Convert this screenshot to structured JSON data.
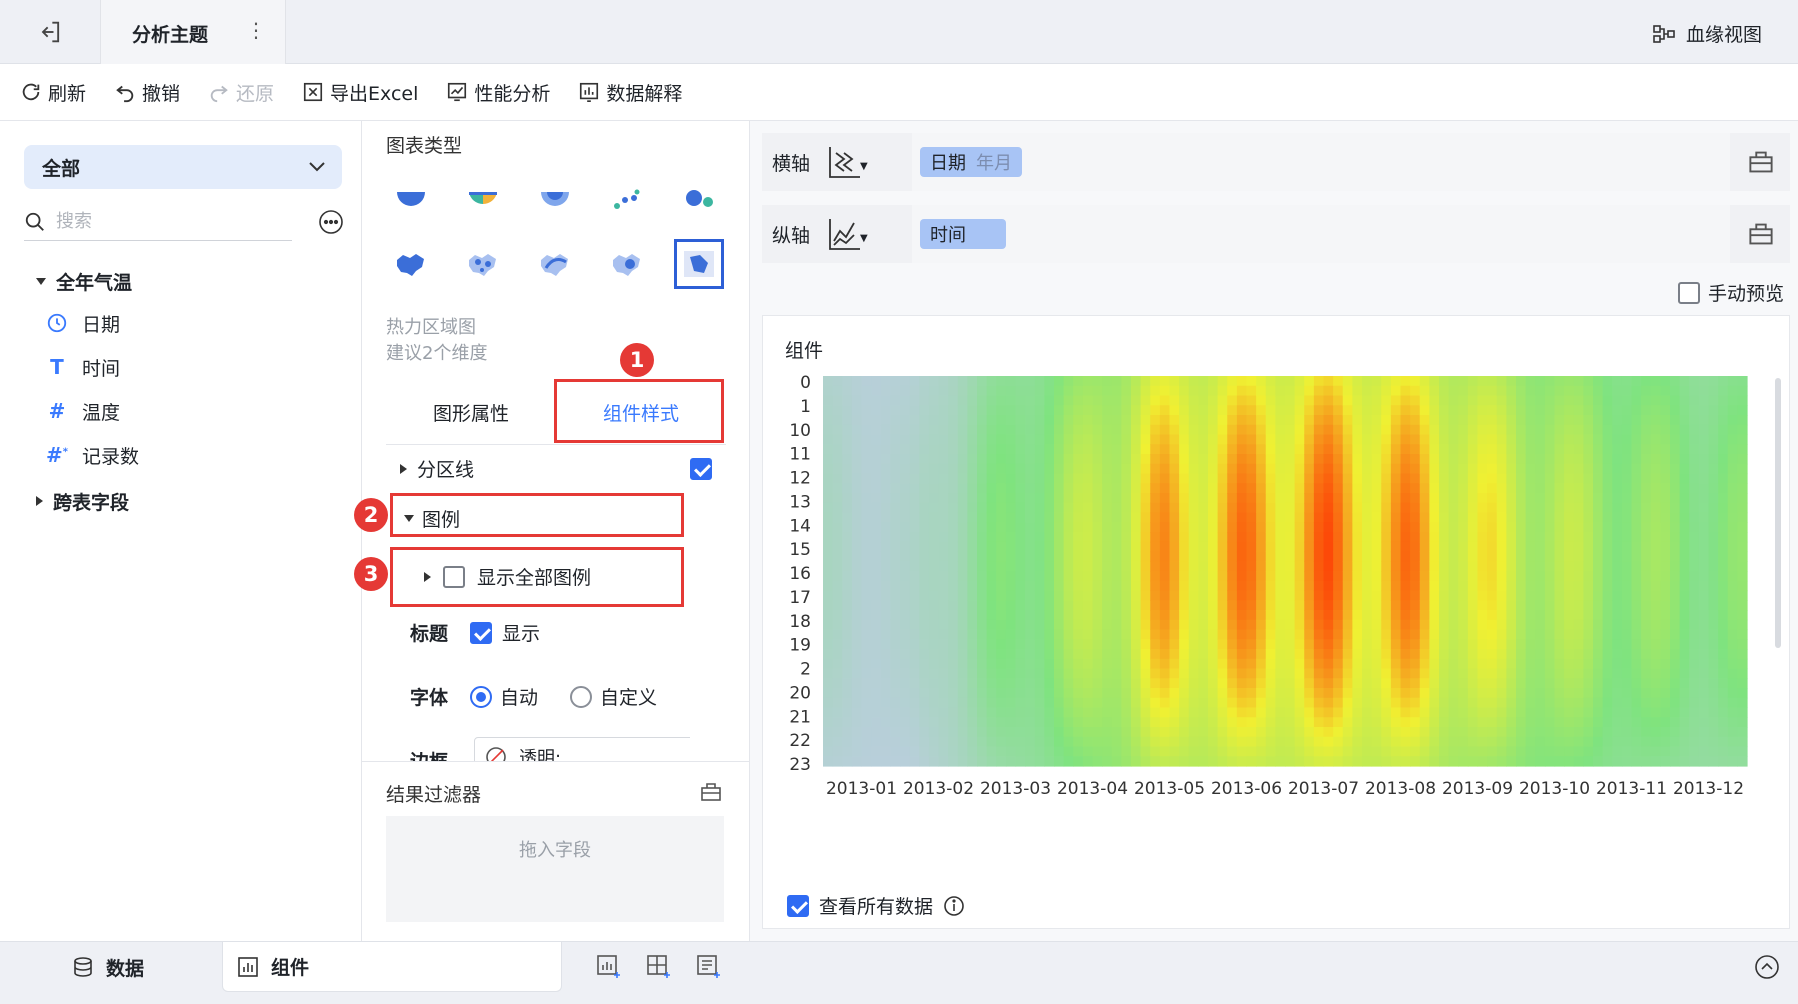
{
  "topbar": {
    "title": "分析主题",
    "lineage_label": "血缘视图"
  },
  "toolbar": {
    "refresh": "刷新",
    "undo": "撤销",
    "redo": "还原",
    "export_excel": "导出Excel",
    "performance": "性能分析",
    "data_explain": "数据解释"
  },
  "left": {
    "dropdown": "全部",
    "search_placeholder": "搜索",
    "group_name": "全年气温",
    "fields": [
      {
        "icon": "clock-icon",
        "name": "日期"
      },
      {
        "icon": "text-icon",
        "name": "时间"
      },
      {
        "icon": "number-icon",
        "name": "温度"
      },
      {
        "icon": "count-icon",
        "name": "记录数"
      }
    ],
    "cross_table": "跨表字段"
  },
  "middle": {
    "chart_type_label": "图表类型",
    "chart_name": "热力区域图",
    "chart_hint": "建议2个维度",
    "tab_shape": "图形属性",
    "tab_style": "组件样式",
    "partition_line": "分区线",
    "legend": "图例",
    "show_all_legend": "显示全部图例",
    "title_label": "标题",
    "title_show": "显示",
    "font_label": "字体",
    "font_auto": "自动",
    "font_custom": "自定义",
    "border_label": "边框",
    "border_value": "透明;",
    "result_filter": "结果过滤器",
    "drop_field": "拖入字段",
    "badges": [
      "1",
      "2",
      "3"
    ]
  },
  "right": {
    "x_axis_label": "横轴",
    "x_field": "日期",
    "x_field_sub": "年月",
    "y_axis_label": "纵轴",
    "y_field": "时间",
    "manual_preview": "手动预览",
    "component_title": "组件",
    "view_all_data": "查看所有数据"
  },
  "chart_data": {
    "type": "heatmap",
    "x_labels": [
      "2013-01",
      "2013-02",
      "2013-03",
      "2013-04",
      "2013-05",
      "2013-06",
      "2013-07",
      "2013-08",
      "2013-09",
      "2013-10",
      "2013-11",
      "2013-12"
    ],
    "y_labels": [
      "0",
      "1",
      "10",
      "11",
      "12",
      "13",
      "14",
      "15",
      "16",
      "17",
      "18",
      "19",
      "2",
      "20",
      "21",
      "22",
      "23"
    ],
    "intensity_by_month": [
      0.15,
      0.12,
      0.35,
      0.55,
      0.85,
      0.9,
      0.95,
      0.9,
      0.7,
      0.55,
      0.45,
      0.4
    ],
    "palette": [
      "#c9c9f5",
      "#7fe37f",
      "#f0f032",
      "#ff2a00"
    ]
  },
  "bottom": {
    "data_tab": "数据",
    "component_tab": "组件"
  },
  "colors": {
    "accent": "#3a7afe",
    "highlight": "#e53935",
    "pill": "#a8c4f5"
  }
}
